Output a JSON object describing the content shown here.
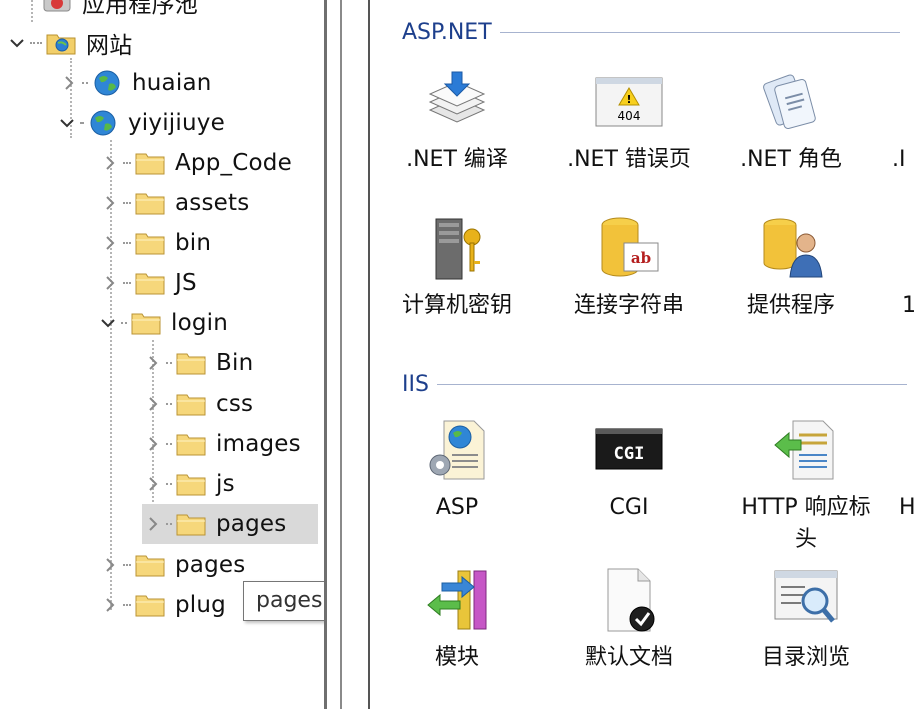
{
  "tree": {
    "top_partial_label": "应用程序池",
    "sites_label": "网站",
    "items": [
      {
        "label": "huaian"
      },
      {
        "label": "yiyijiuye"
      },
      {
        "label": "App_Code"
      },
      {
        "label": "assets"
      },
      {
        "label": "bin"
      },
      {
        "label": "JS"
      },
      {
        "label": "login"
      },
      {
        "label": "Bin"
      },
      {
        "label": "css"
      },
      {
        "label": "images"
      },
      {
        "label": "js"
      },
      {
        "label": "pages"
      },
      {
        "label": "pages"
      },
      {
        "label": "plug"
      }
    ],
    "tooltip": "pages"
  },
  "features": {
    "groups": [
      {
        "name": "ASP.NET",
        "items": [
          {
            "label": ".NET 编译",
            "icon": "net-compile-icon"
          },
          {
            "label": ".NET 错误页",
            "icon": "error-404-icon"
          },
          {
            "label": ".NET 角色",
            "icon": "net-roles-icon"
          },
          {
            "label": ".I",
            "icon": ""
          },
          {
            "label": "计算机密钥",
            "icon": "machine-key-icon"
          },
          {
            "label": "连接字符串",
            "icon": "connection-string-icon"
          },
          {
            "label": "提供程序",
            "icon": "providers-icon"
          },
          {
            "label": "1",
            "icon": ""
          }
        ]
      },
      {
        "name": "IIS",
        "items": [
          {
            "label": "ASP",
            "icon": "asp-icon"
          },
          {
            "label": "CGI",
            "icon": "cgi-icon"
          },
          {
            "label": "HTTP 响应标头",
            "line1": "HTTP 响应标",
            "line2": "头",
            "icon": "http-response-headers-icon"
          },
          {
            "label": "H",
            "icon": ""
          },
          {
            "label": "模块",
            "icon": "modules-icon"
          },
          {
            "label": "默认文档",
            "icon": "default-document-icon"
          },
          {
            "label": "目录浏览",
            "icon": "directory-browsing-icon"
          }
        ]
      }
    ],
    "cgi_badge": "CGI",
    "error_badge": "404",
    "conn_badge": "ab"
  }
}
